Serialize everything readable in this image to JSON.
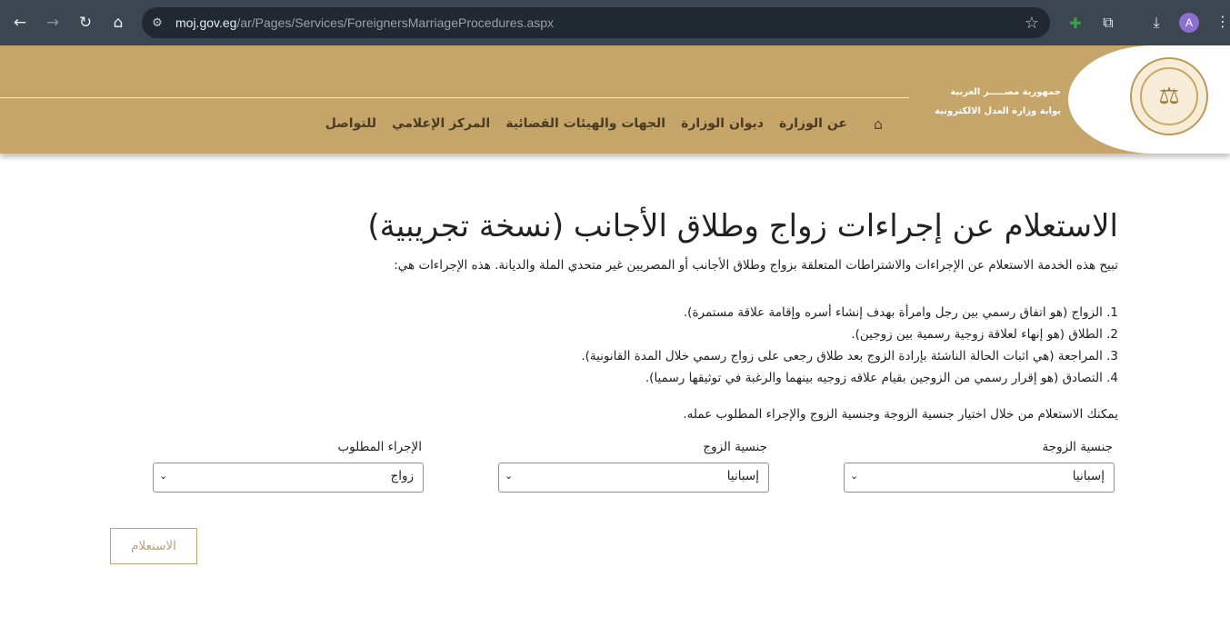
{
  "browser": {
    "back_icon": "←",
    "forward_icon": "→",
    "reload_icon": "↻",
    "home_icon": "⌂",
    "tune_icon": "⚙",
    "url_host": "moj.gov.eg",
    "url_path": "/ar/Pages/Services/ForeignersMarriageProcedures.aspx",
    "bookmark_icon": "☆",
    "extension_icon": "✚",
    "puzzle_icon": "⧉",
    "download_icon": "⤓",
    "avatar_letter": "A",
    "menu_icon": "⋮"
  },
  "site": {
    "brand_line1": "جمهورية مصـــــر العربية",
    "brand_line2": "بوابة وزارة العدل الالكترونية",
    "home_icon": "⌂",
    "seal_icon": "⚖",
    "menu": [
      "عن الوزارة",
      "ديوان الوزارة",
      "الجهات والهيئات القضائية",
      "المركز الإعلامي",
      "للتواصل"
    ],
    "header_color": "#c6a56b"
  },
  "main": {
    "title": "الاستعلام عن إجراءات زواج وطلاق الأجانب (نسخة تجريبية)",
    "intro": "تبيح هذه الخدمة الاستعلام عن الإجراءات والاشتراطات المتعلقة بزواج وطلاق الأجانب أو المصريين غير متحدي الملة والديانة. هذه الإجراءات هي:",
    "steps": [
      "1. الزواج (هو اتفاق رسمي بين رجل وامرأة بهدف إنشاء أسره وإقامة علاقة مستمرة).",
      "2. الطلاق (هو إنهاء لعلاقة زوجية رسمية بين زوجين).",
      "3. المراجعة (هي اثبات الحالة الناشئة بإرادة الزوج بعد طلاق رجعى على زواج رسمي خلال المدة القانونية).",
      "4. التصادق (هو إقرار رسمي من الزوجين بقيام علاقه زوجيه بينهما والرغبة في توثيقها رسميا)."
    ],
    "hint": "يمكنك الاستعلام من خلال اختيار جنسية الزوجة وجنسية الزوج والإجراء المطلوب عمله."
  },
  "form": {
    "wife_label": "جنسية الزوجة",
    "wife_value": "إسبانيا",
    "husband_label": "جنسية الزوج",
    "husband_value": "إسبانيا",
    "procedure_label": "الإجراء المطلوب",
    "procedure_value": "زواج",
    "chevron_icon": "⌄",
    "submit_label": "الاستعلام"
  }
}
